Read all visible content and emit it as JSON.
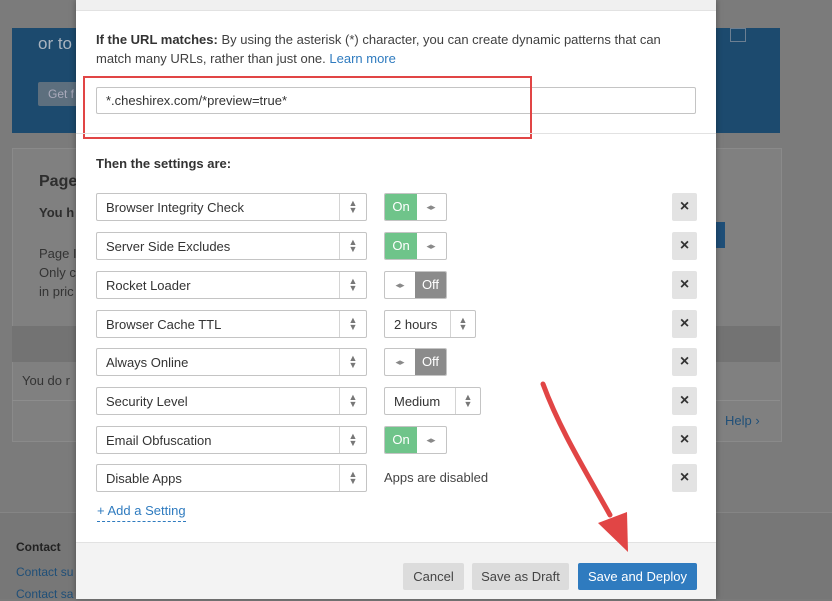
{
  "background": {
    "hero_text": "or to",
    "hero_button": "Get f",
    "card_title": "Page",
    "card_subtitle": "You h",
    "card_text_lines": [
      "Page I",
      "Only c",
      "in pric"
    ],
    "empty_text": "You do r",
    "help_link": "Help ›",
    "footer_contact": "Contact",
    "footer_links": [
      "Contact su",
      "Contact sa"
    ]
  },
  "url_section": {
    "label_bold": "If the URL matches:",
    "description": " By using the asterisk (*) character, you can create dynamic patterns that can match many URLs, rather than just one. ",
    "learn_more": "Learn more",
    "url_value": "*.cheshirex.com/*preview=true*"
  },
  "settings_title": "Then the settings are:",
  "settings": [
    {
      "label": "Browser Integrity Check",
      "control": "toggle",
      "state": "On"
    },
    {
      "label": "Server Side Excludes",
      "control": "toggle",
      "state": "On"
    },
    {
      "label": "Rocket Loader",
      "control": "toggle",
      "state": "Off"
    },
    {
      "label": "Browser Cache TTL",
      "control": "select",
      "value": "2 hours"
    },
    {
      "label": "Always Online",
      "control": "toggle",
      "state": "Off"
    },
    {
      "label": "Security Level",
      "control": "select",
      "value": "Medium"
    },
    {
      "label": "Email Obfuscation",
      "control": "toggle",
      "state": "On"
    },
    {
      "label": "Disable Apps",
      "control": "text",
      "value": "Apps are disabled"
    }
  ],
  "delete_glyph": "×",
  "add_setting": "+ Add a Setting",
  "footer": {
    "cancel": "Cancel",
    "save_draft": "Save as Draft",
    "save_deploy": "Save and Deploy"
  },
  "colors": {
    "toggle_on": "#6fc48a",
    "toggle_off": "#8b8b8b",
    "primary_button": "#2f7bbf",
    "annotation_red": "#e14545"
  }
}
